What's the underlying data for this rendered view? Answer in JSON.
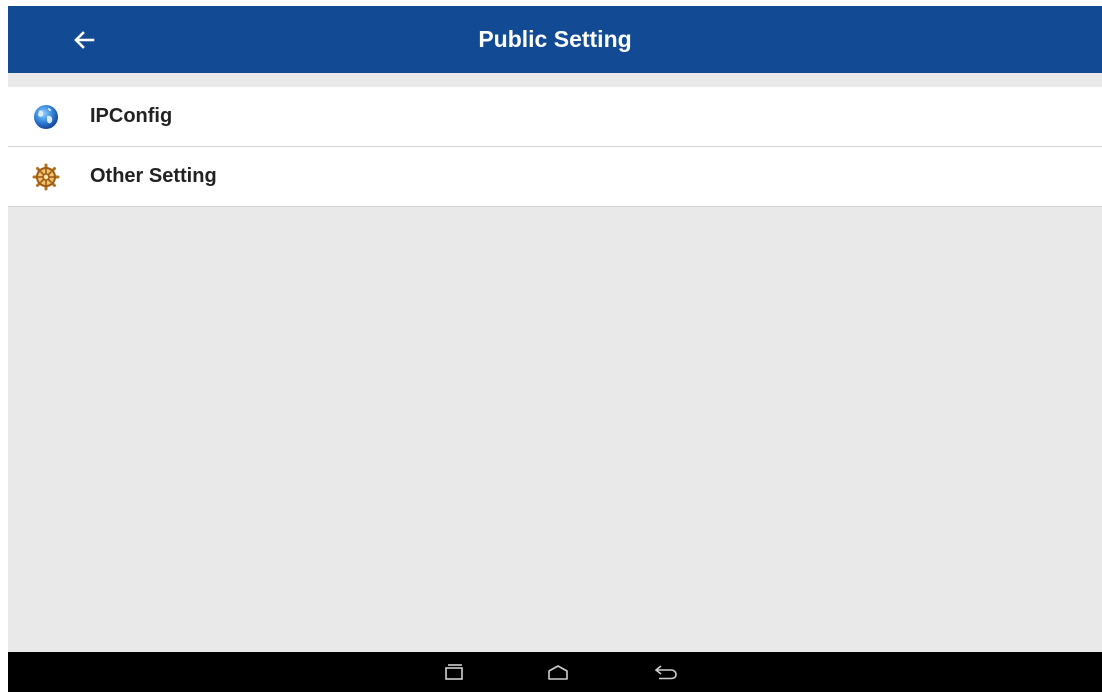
{
  "appbar": {
    "title": "Public Setting",
    "background": "#124a93",
    "back_icon": "arrow-left-icon"
  },
  "list": {
    "items": [
      {
        "label": "IPConfig",
        "icon": "globe-icon"
      },
      {
        "label": "Other Setting",
        "icon": "gear-icon"
      }
    ]
  },
  "navbar": {
    "buttons": [
      {
        "icon": "recent-apps-icon"
      },
      {
        "icon": "home-icon"
      },
      {
        "icon": "back-icon"
      }
    ]
  }
}
